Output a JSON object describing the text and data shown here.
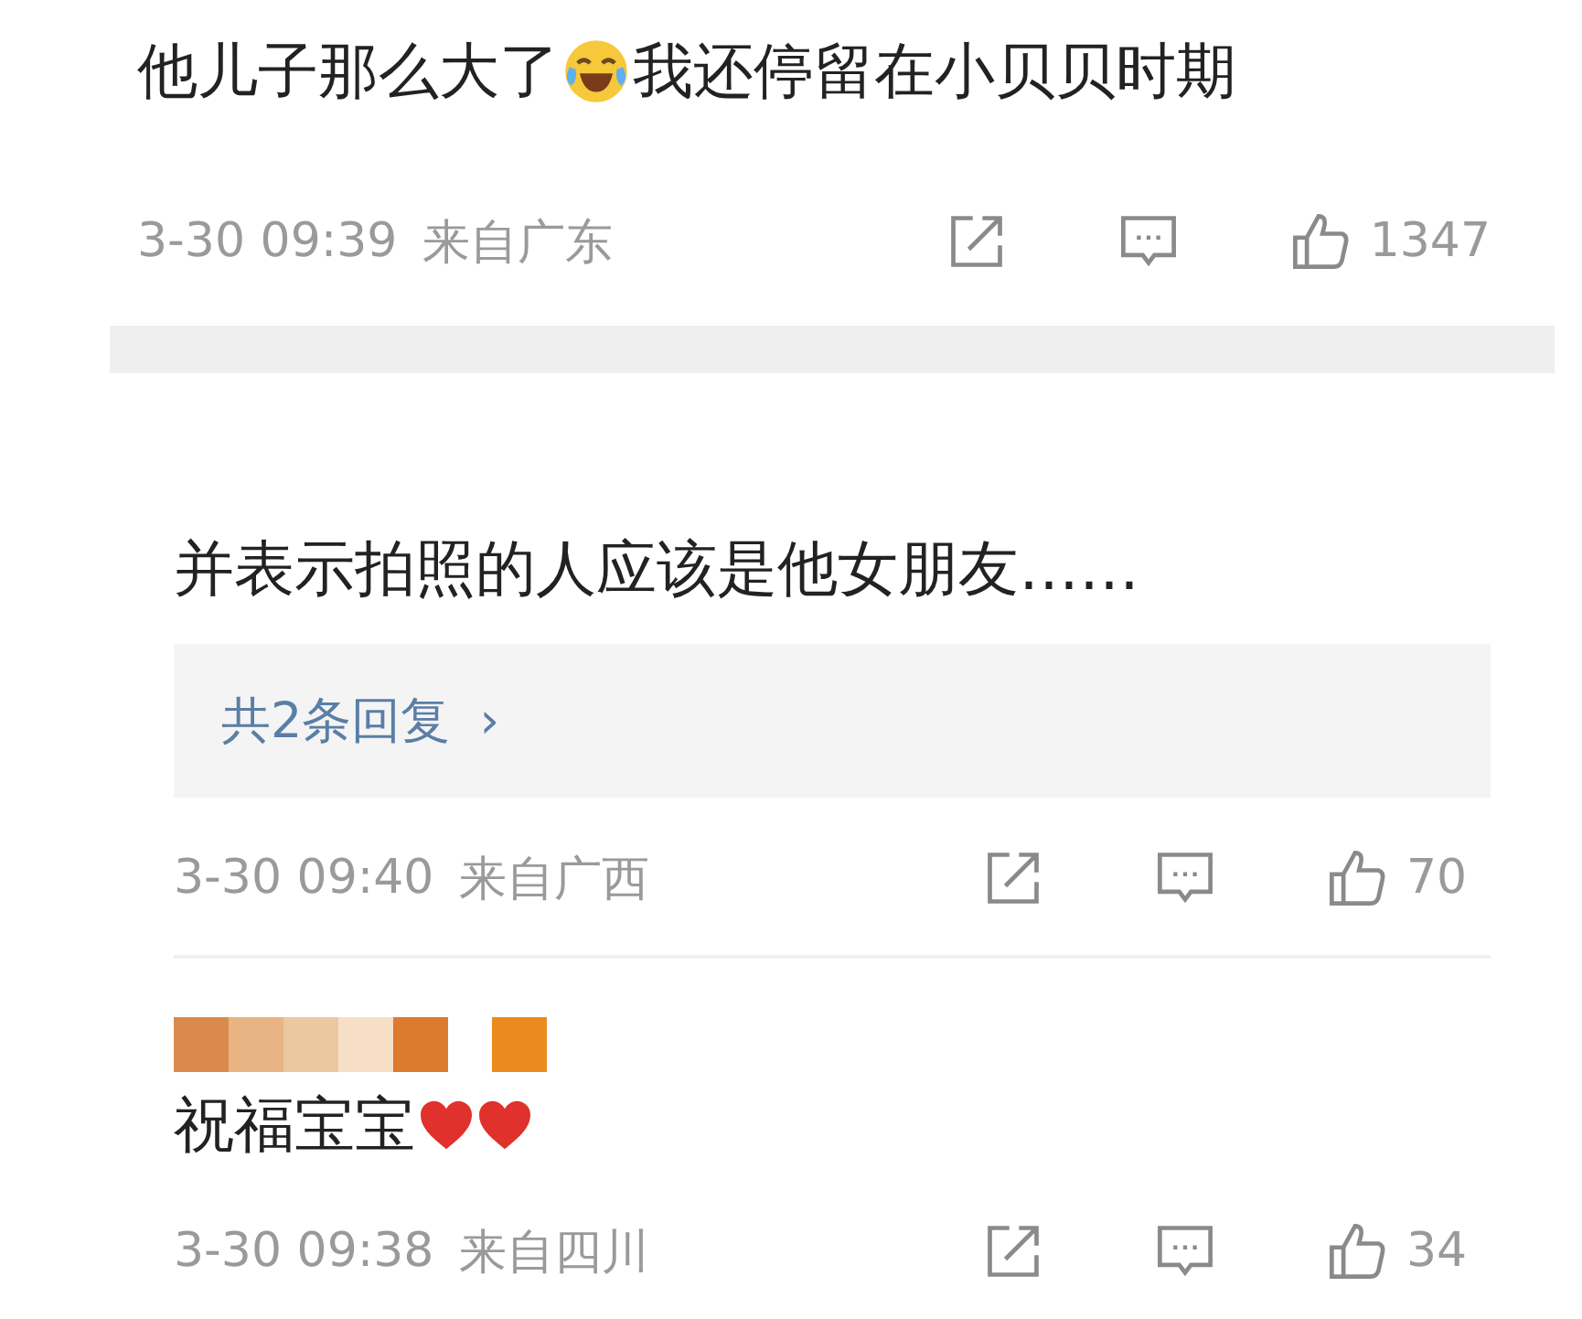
{
  "comments": [
    {
      "segments": [
        {
          "kind": "text",
          "text": "他儿子那么大了"
        },
        {
          "kind": "laugh-cry"
        },
        {
          "kind": "text",
          "text": "我还停留在小贝贝时期"
        }
      ],
      "time": "3-30 09:39",
      "location": "来自广东",
      "likes": "1347"
    },
    {
      "segments": [
        {
          "kind": "text",
          "text": "并表示拍照的人应该是他女朋友……"
        }
      ],
      "replies": {
        "label": "共2条回复",
        "arrow": "›"
      },
      "time": "3-30 09:40",
      "location": "来自广西",
      "likes": "70"
    },
    {
      "username_mosaic": [
        [
          {
            "color": "#d98a4c"
          },
          {
            "color": "#e9b483"
          },
          {
            "color": "#ecc8a0"
          },
          {
            "color": "#f7dfc6"
          },
          {
            "color": "#de7a2e"
          }
        ],
        [
          {
            "color": "#eb8a1f"
          }
        ]
      ],
      "segments": [
        {
          "kind": "text",
          "text": "祝福宝宝"
        },
        {
          "kind": "heart"
        },
        {
          "kind": "heart"
        }
      ],
      "time": "3-30 09:38",
      "location": "来自四川",
      "likes": "34"
    }
  ]
}
